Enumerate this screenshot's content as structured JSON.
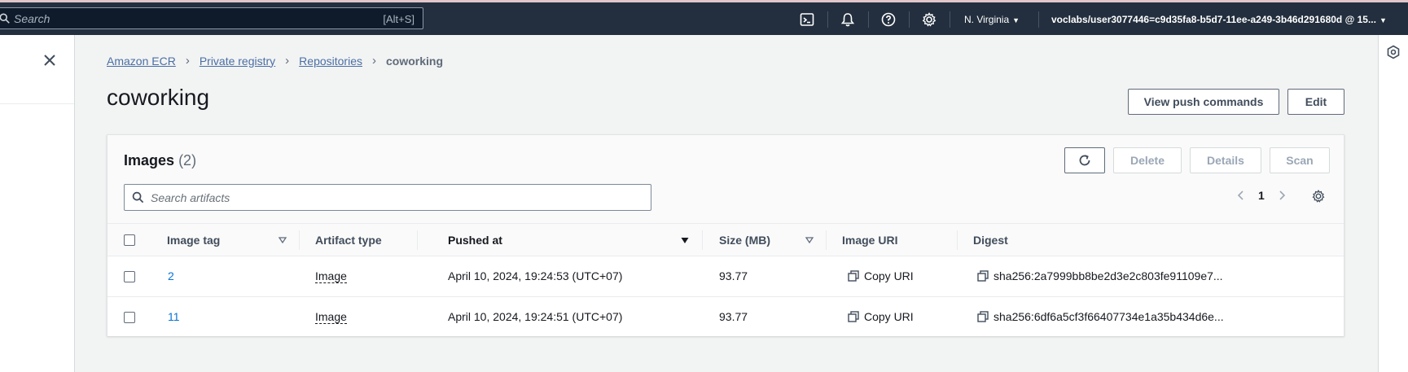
{
  "topbar": {
    "search_placeholder": "Search",
    "search_shortcut": "[Alt+S]",
    "region": "N. Virginia",
    "account": "voclabs/user3077446=c9d35fa8-b5d7-11ee-a249-3b46d291680d @ 15..."
  },
  "breadcrumb": {
    "items": [
      "Amazon ECR",
      "Private registry",
      "Repositories"
    ],
    "current": "coworking"
  },
  "page": {
    "title": "coworking",
    "view_push_commands": "View push commands",
    "edit": "Edit"
  },
  "images_panel": {
    "title": "Images",
    "count": "(2)",
    "delete": "Delete",
    "details": "Details",
    "scan": "Scan",
    "search_placeholder": "Search artifacts",
    "page_number": "1",
    "columns": {
      "image_tag": "Image tag",
      "artifact_type": "Artifact type",
      "pushed_at": "Pushed at",
      "size": "Size (MB)",
      "image_uri": "Image URI",
      "digest": "Digest"
    },
    "rows": [
      {
        "tag": "2",
        "artifact_type": "Image",
        "pushed_at": "April 10, 2024, 19:24:53 (UTC+07)",
        "size": "93.77",
        "image_uri": "Copy URI",
        "digest": "sha256:2a7999bb8be2d3e2c803fe91109e7..."
      },
      {
        "tag": "11",
        "artifact_type": "Image",
        "pushed_at": "April 10, 2024, 19:24:51 (UTC+07)",
        "size": "93.77",
        "image_uri": "Copy URI",
        "digest": "sha256:6df6a5cf3f66407734e1a35b434d6e..."
      }
    ]
  },
  "colors": {
    "topbar_bg": "#232f3e",
    "link": "#0972d3",
    "page_bg": "#f2f3f3"
  }
}
